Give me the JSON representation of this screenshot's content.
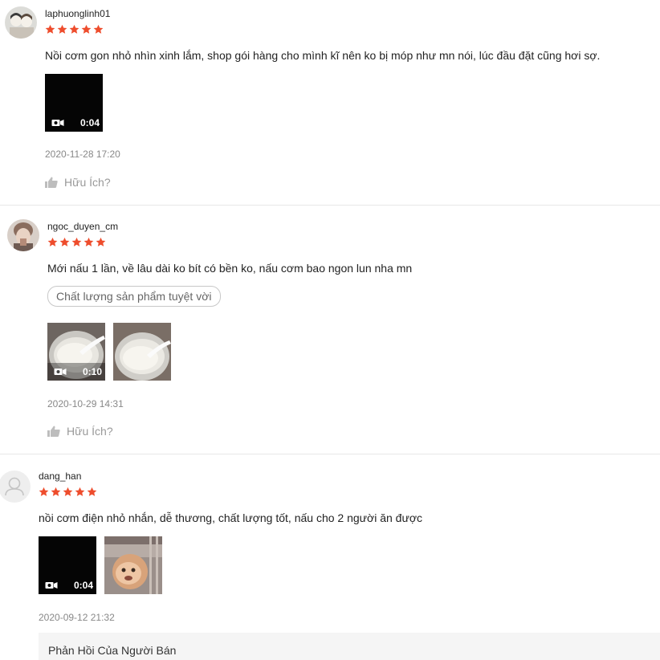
{
  "reviews": [
    {
      "username": "laphuonglinh01",
      "rating": 5,
      "comment": "Nồi cơm gon nhỏ nhìn xinh lắm, shop gói hàng cho mình kĩ nên ko bị móp như mn nói, lúc đầu đặt cũng hơi sợ.",
      "media": [
        {
          "type": "video",
          "duration": "0:04"
        }
      ],
      "timestamp": "2020-11-28 17:20",
      "helpful_label": "Hữu Ích?"
    },
    {
      "username": "ngoc_duyen_cm",
      "rating": 5,
      "comment": "Mới nấu 1 lần, về lâu dài ko bít có bền ko, nấu cơm bao ngon lun nha mn",
      "tag": "Chất lượng sản phẩm tuyệt vời",
      "media": [
        {
          "type": "video",
          "duration": "0:10"
        },
        {
          "type": "image"
        }
      ],
      "timestamp": "2020-10-29 14:31",
      "helpful_label": "Hữu Ích?"
    },
    {
      "username": "dang_han",
      "rating": 5,
      "comment": "nồi cơm điện nhỏ nhắn, dễ thương, chất lượng tốt, nấu cho 2 người ăn được",
      "media": [
        {
          "type": "video",
          "duration": "0:04"
        },
        {
          "type": "image"
        }
      ],
      "timestamp": "2020-09-12 21:32"
    }
  ],
  "seller_reply": {
    "title": "Phản Hồi Của Người Bán"
  },
  "colors": {
    "star": "#ee4d2d",
    "divider": "#e8e8e8",
    "muted_text": "#888888"
  },
  "icons": {
    "star": "star-icon",
    "video": "video-camera-icon",
    "helpful": "thumbs-up-icon",
    "default_avatar": "user-silhouette-icon"
  }
}
